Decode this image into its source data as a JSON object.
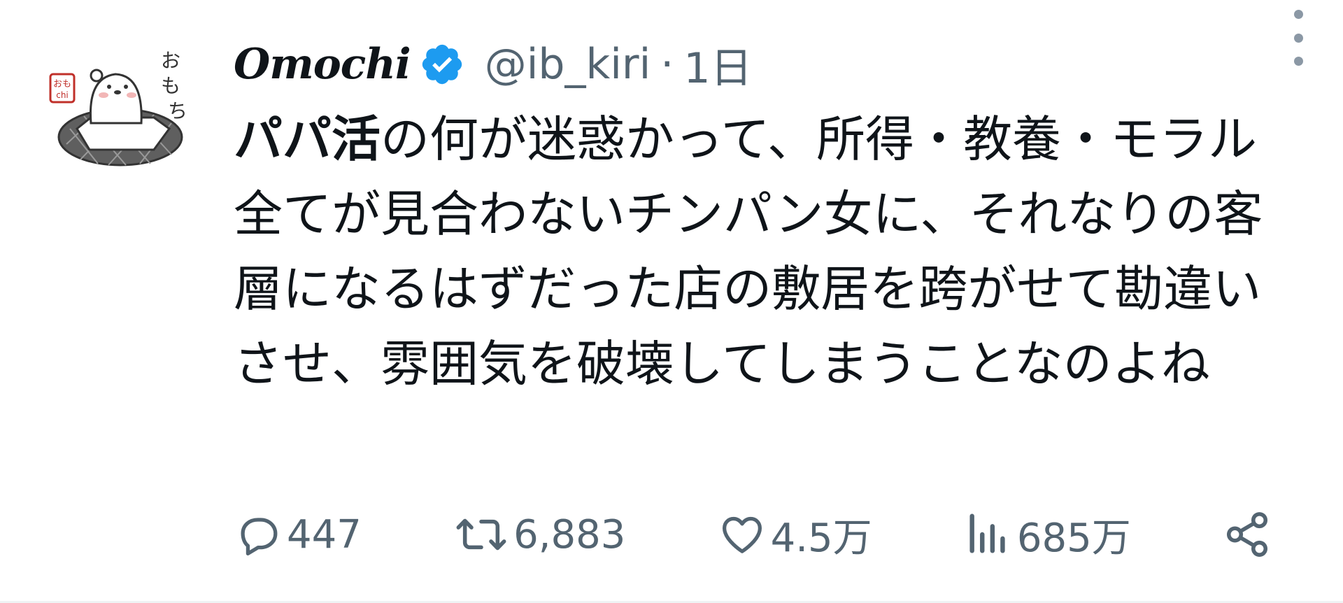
{
  "tweet": {
    "avatar_icon": "omochi-avatar",
    "display_name": "Omochi",
    "verified_icon": "verified-badge-icon",
    "handle": "@ib_kiri",
    "separator": "·",
    "time": "1日",
    "more_icon": "more-vertical-icon",
    "text_highlight": "パパ活",
    "text_rest": "の何が迷惑かって、所得・教養・モラル全てが見合わないチンパン女に、それなりの客層になるはずだった店の敷居を跨がせて勘違いさせ、雰囲気を破壊してしまうことなのよね"
  },
  "actions": {
    "reply": {
      "icon": "reply-icon",
      "count": "447"
    },
    "retweet": {
      "icon": "retweet-icon",
      "count": "6,883"
    },
    "like": {
      "icon": "heart-icon",
      "count": "4.5万"
    },
    "views": {
      "icon": "views-icon",
      "count": "685万"
    },
    "share": {
      "icon": "share-icon"
    }
  },
  "colors": {
    "text_primary": "#0f1419",
    "text_secondary": "#536471",
    "verified_blue": "#1d9bf0"
  }
}
